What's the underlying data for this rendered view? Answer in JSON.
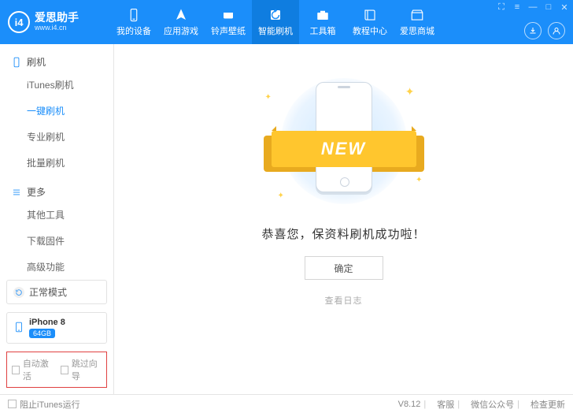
{
  "app": {
    "name": "爱思助手",
    "url": "www.i4.cn",
    "logo_text": "i4"
  },
  "nav": [
    {
      "label": "我的设备",
      "icon": "device"
    },
    {
      "label": "应用游戏",
      "icon": "apps"
    },
    {
      "label": "铃声壁纸",
      "icon": "music"
    },
    {
      "label": "智能刷机",
      "icon": "flash",
      "active": true
    },
    {
      "label": "工具箱",
      "icon": "toolbox"
    },
    {
      "label": "教程中心",
      "icon": "book"
    },
    {
      "label": "爱思商城",
      "icon": "shop"
    }
  ],
  "sidebar": {
    "section_flash": "刷机",
    "flash_items": [
      "iTunes刷机",
      "一键刷机",
      "专业刷机",
      "批量刷机"
    ],
    "flash_active_index": 1,
    "section_more": "更多",
    "more_items": [
      "其他工具",
      "下载固件",
      "高级功能"
    ],
    "mode": "正常模式",
    "device": {
      "name": "iPhone 8",
      "storage": "64GB"
    },
    "checks": {
      "auto_activate": "自动激活",
      "skip_guide": "跳过向导"
    }
  },
  "main": {
    "ribbon": "NEW",
    "message": "恭喜您，保资料刷机成功啦！",
    "ok": "确定",
    "view_log": "查看日志"
  },
  "footer": {
    "block_itunes": "阻止iTunes运行",
    "version": "V8.12",
    "support": "客服",
    "wechat": "微信公众号",
    "update": "检查更新"
  }
}
